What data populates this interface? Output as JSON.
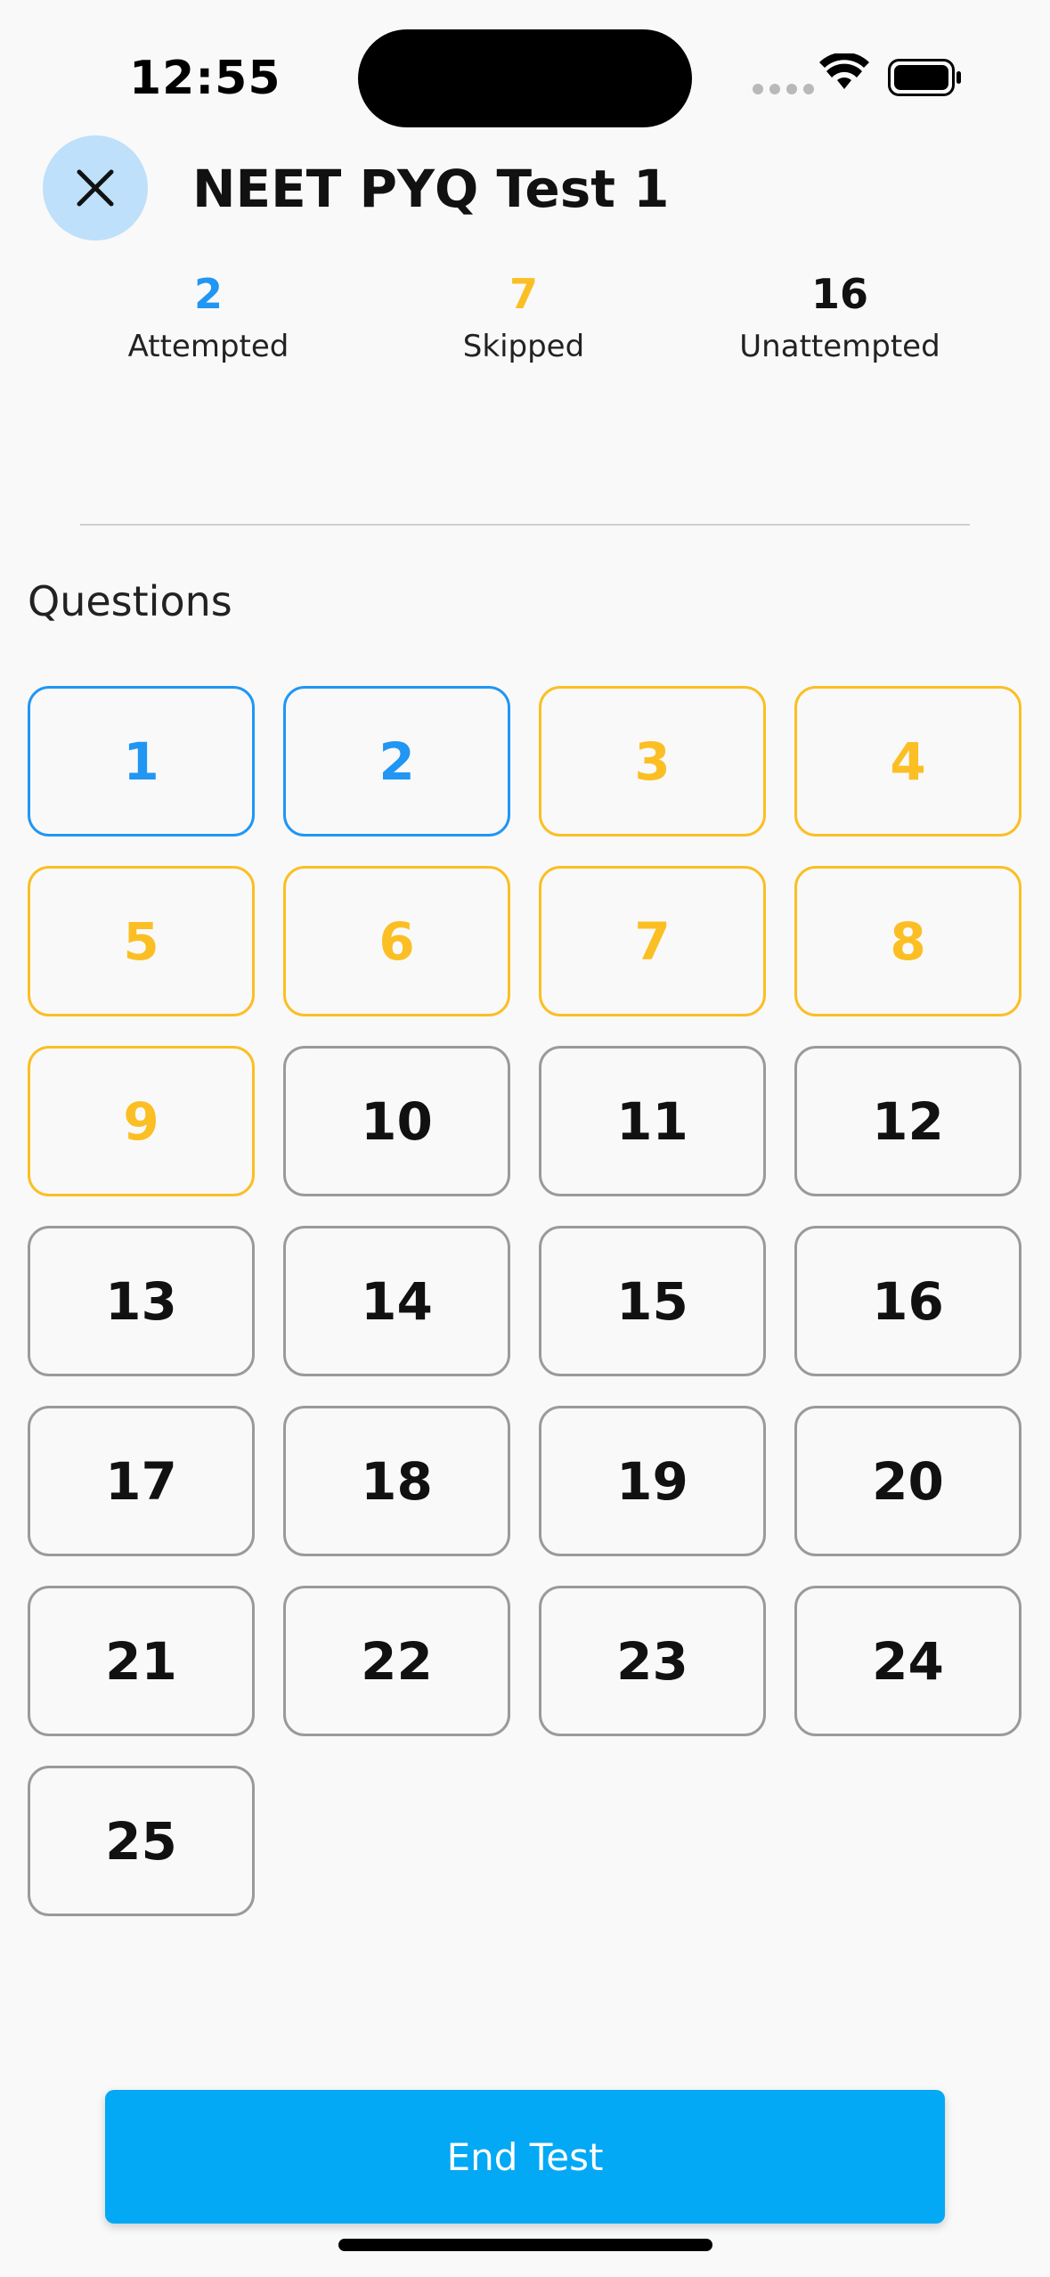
{
  "status_bar": {
    "time": "12:55"
  },
  "header": {
    "title": "NEET PYQ Test 1"
  },
  "stats": {
    "attempted": {
      "value": "2",
      "label": "Attempted",
      "color": "#2196f3"
    },
    "skipped": {
      "value": "7",
      "label": "Skipped",
      "color": "#fbbf24"
    },
    "unattempted": {
      "value": "16",
      "label": "Unattempted",
      "color": "#111111"
    }
  },
  "questions_section": {
    "label": "Questions"
  },
  "questions": [
    {
      "number": "1",
      "state": "attempted"
    },
    {
      "number": "2",
      "state": "attempted"
    },
    {
      "number": "3",
      "state": "skipped"
    },
    {
      "number": "4",
      "state": "skipped"
    },
    {
      "number": "5",
      "state": "skipped"
    },
    {
      "number": "6",
      "state": "skipped"
    },
    {
      "number": "7",
      "state": "skipped"
    },
    {
      "number": "8",
      "state": "skipped"
    },
    {
      "number": "9",
      "state": "skipped"
    },
    {
      "number": "10",
      "state": "unattempted"
    },
    {
      "number": "11",
      "state": "unattempted"
    },
    {
      "number": "12",
      "state": "unattempted"
    },
    {
      "number": "13",
      "state": "unattempted"
    },
    {
      "number": "14",
      "state": "unattempted"
    },
    {
      "number": "15",
      "state": "unattempted"
    },
    {
      "number": "16",
      "state": "unattempted"
    },
    {
      "number": "17",
      "state": "unattempted"
    },
    {
      "number": "18",
      "state": "unattempted"
    },
    {
      "number": "19",
      "state": "unattempted"
    },
    {
      "number": "20",
      "state": "unattempted"
    },
    {
      "number": "21",
      "state": "unattempted"
    },
    {
      "number": "22",
      "state": "unattempted"
    },
    {
      "number": "23",
      "state": "unattempted"
    },
    {
      "number": "24",
      "state": "unattempted"
    },
    {
      "number": "25",
      "state": "unattempted"
    }
  ],
  "footer": {
    "end_button_label": "End Test",
    "accent": "#03a9f4"
  },
  "icons": {
    "close": "close-icon",
    "wifi": "wifi-icon",
    "battery": "battery-icon",
    "signal": "signal-icon"
  }
}
